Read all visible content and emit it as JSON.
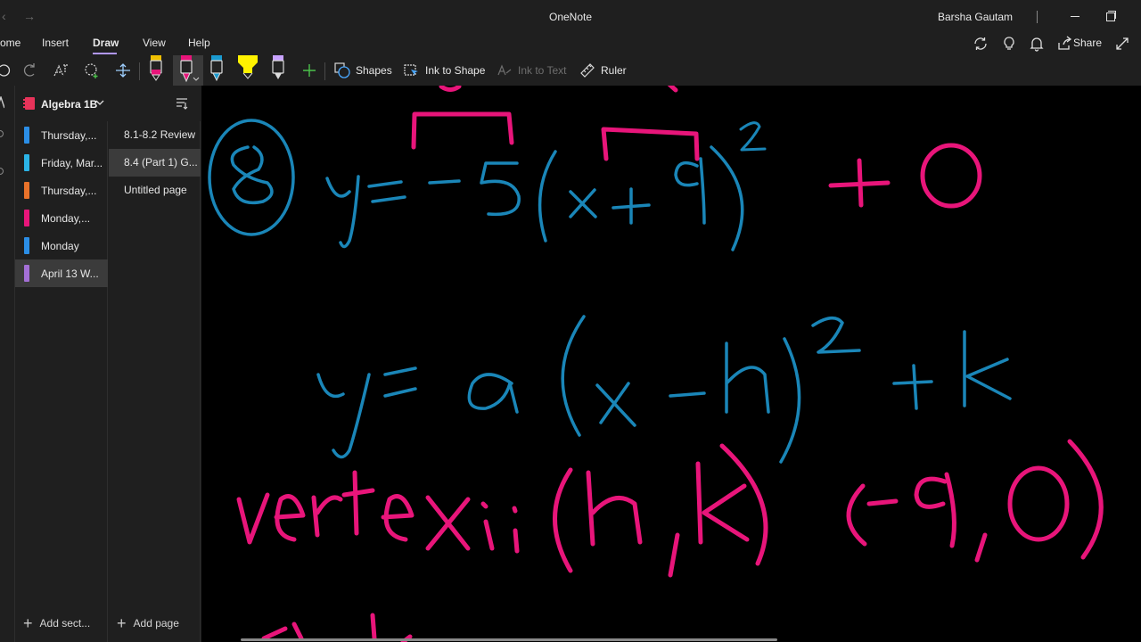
{
  "window": {
    "title": "OneNote",
    "user": "Barsha Gautam"
  },
  "ribbon": {
    "tabs": [
      {
        "label": "ome"
      },
      {
        "label": "Insert"
      },
      {
        "label": "Draw"
      },
      {
        "label": "View"
      },
      {
        "label": "Help"
      }
    ],
    "active_tab": "Draw",
    "share_label": "Share"
  },
  "toolbar": {
    "shapes_label": "Shapes",
    "ink_to_shape_label": "Ink to Shape",
    "ink_to_text_label": "Ink to Text",
    "ruler_label": "Ruler",
    "pens": [
      {
        "icon": "pen-black-icon",
        "color": "#f0c000"
      },
      {
        "icon": "pen-pink-icon",
        "color": "#e8157a"
      },
      {
        "icon": "pen-blue-icon",
        "color": "#1a9ad0"
      },
      {
        "icon": "highlighter-yellow-icon",
        "color": "#fff200"
      },
      {
        "icon": "highlighter-purple-icon",
        "color": "#c8a2ff"
      }
    ]
  },
  "notebook": {
    "name": "Algebra 1B"
  },
  "sections": [
    {
      "label": "Thursday,...",
      "color": "#2b8ee6"
    },
    {
      "label": "Friday, Mar...",
      "color": "#2b8ee6"
    },
    {
      "label": "Thursday,...",
      "color": "#e8722a"
    },
    {
      "label": "Monday,...",
      "color": "#e8157a"
    },
    {
      "label": "Monday",
      "color": "#2b8ee6"
    },
    {
      "label": "April 13 W...",
      "color": "#a46fd6"
    }
  ],
  "pages": [
    {
      "label": "8.1-8.2 Review"
    },
    {
      "label": "8.4 (Part 1) G..."
    },
    {
      "label": "Untitled page"
    }
  ],
  "add_section_label": "Add sect...",
  "add_page_label": "Add page",
  "ink": {
    "problem_number": "8",
    "equation_1": "y = -5(x + 9)² + 0",
    "equation_2": "y = a(x - h)² + k",
    "vertex_line": "vertex: (h,k)  (-9,0)",
    "blue_color": "#1a86b8",
    "pink_color": "#e8157a"
  }
}
